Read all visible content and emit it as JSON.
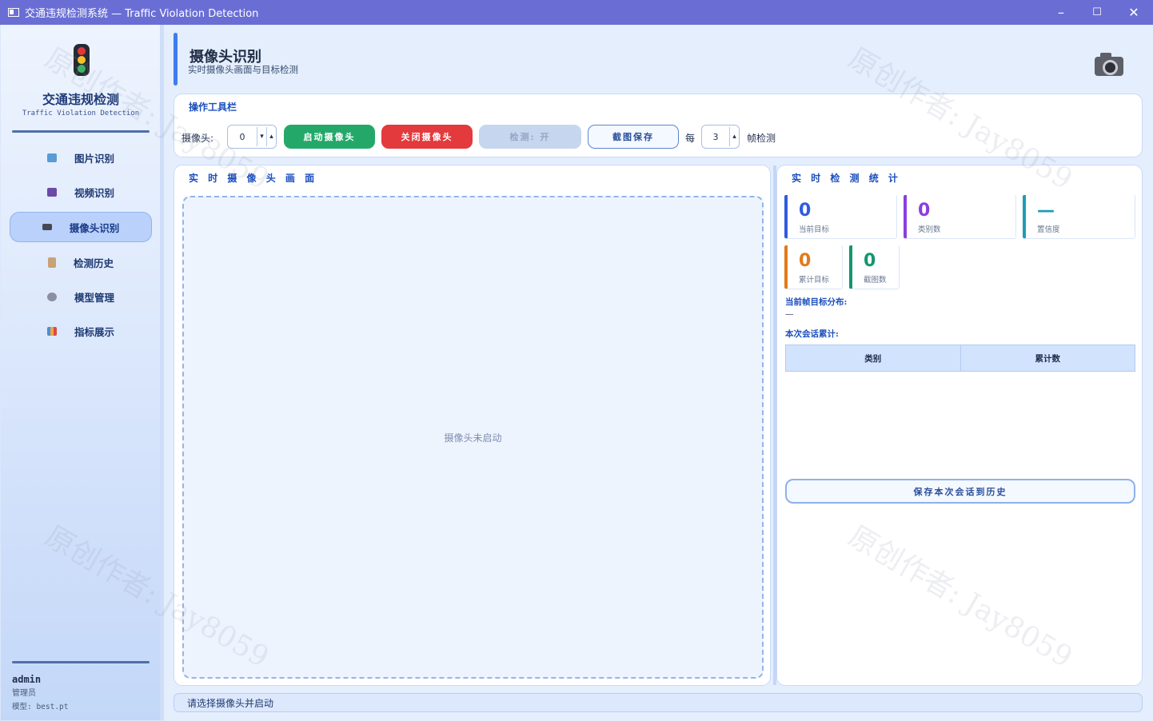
{
  "window": {
    "title": "交通违规检测系统 — Traffic Violation Detection",
    "min": "–",
    "max": "☐",
    "close": "✕"
  },
  "sidebar": {
    "brand": "交通违规检测",
    "brand_sub": "Traffic Violation Detection",
    "items": [
      {
        "label": "图片识别",
        "icon": "image-icon",
        "color": "#5b9bd5"
      },
      {
        "label": "视频识别",
        "icon": "clapper-icon",
        "color": "#6b4aa8"
      },
      {
        "label": "摄像头识别",
        "icon": "camera-icon",
        "color": "#444852",
        "active": true
      },
      {
        "label": "检测历史",
        "icon": "scroll-icon",
        "color": "#b08060"
      },
      {
        "label": "模型管理",
        "icon": "gear-icon",
        "color": "#8a8fa3"
      },
      {
        "label": "指标展示",
        "icon": "bar-chart-icon",
        "color": "#4a8fd8"
      }
    ],
    "user": "admin",
    "role": "管理员",
    "model": "模型: best.pt"
  },
  "header": {
    "title": "摄像头识别",
    "subtitle": "实时摄像头画面与目标检测"
  },
  "toolbar": {
    "title": "操作工具栏",
    "camera_label": "摄像头:",
    "camera_value": "0",
    "start": "启动摄像头",
    "stop": "关闭摄像头",
    "detect": "检测: 开",
    "capture": "截图保存",
    "every": "每",
    "frame_value": "3",
    "frame_label": "帧检测"
  },
  "preview": {
    "title": "实 时 摄 像 头 画 面",
    "placeholder": "摄像头未启动"
  },
  "stats": {
    "title": "实 时 检 测 统 计",
    "cards": [
      {
        "value": "0",
        "label": "当前目标",
        "color": "#2f5be0"
      },
      {
        "value": "0",
        "label": "类别数",
        "color": "#8a3ee0"
      },
      {
        "value": "—",
        "label": "置信度",
        "color": "#1b9eb3"
      },
      {
        "value": "0",
        "label": "累计目标",
        "color": "#e27a17"
      },
      {
        "value": "0",
        "label": "截图数",
        "color": "#149670"
      }
    ],
    "frame_dist_label": "当前帧目标分布:",
    "frame_dist_value": "—",
    "session_label": "本次会话累计:",
    "table_headers": [
      "类别",
      "累计数"
    ],
    "save_button": "保存本次会话到历史"
  },
  "status_bar": "请选择摄像头并启动",
  "watermark": "原创作者: Jay8059"
}
